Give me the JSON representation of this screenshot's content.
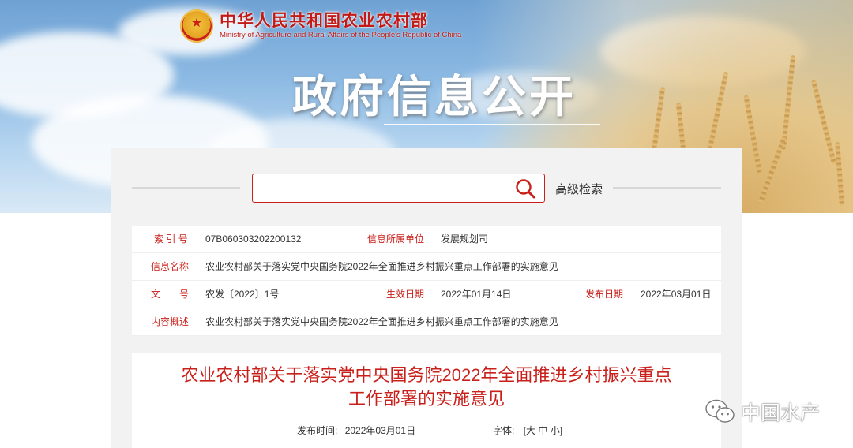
{
  "header": {
    "ministry_name_cn": "中华人民共和国农业农村部",
    "ministry_name_en": "Ministry of Agriculture and Rural Affairs of the People's Republic of China",
    "page_heading": "政府信息公开"
  },
  "search": {
    "placeholder": "",
    "value": "",
    "advanced_label": "高级检索"
  },
  "info": {
    "index_label": "索 引 号",
    "index_value": "07B060303202200132",
    "unit_label": "信息所属单位",
    "unit_value": "发展规划司",
    "name_label": "信息名称",
    "name_value": "农业农村部关于落实党中央国务院2022年全面推进乡村振兴重点工作部署的实施意见",
    "doc_label": "文　　号",
    "doc_value": "农发〔2022〕1号",
    "effective_label": "生效日期",
    "effective_value": "2022年01月14日",
    "publish_label": "发布日期",
    "publish_value": "2022年03月01日",
    "summary_label": "内容概述",
    "summary_value": "农业农村部关于落实党中央国务院2022年全面推进乡村振兴重点工作部署的实施意见"
  },
  "article": {
    "title_line1": "农业农村部关于落实党中央国务院2022年全面推进乡村振兴重点",
    "title_line2": "工作部署的实施意见",
    "publish_time_label": "发布时间:",
    "publish_time_value": "2022年03月01日",
    "font_label": "字体:",
    "font_open": "[",
    "font_large": "大",
    "font_medium": "中",
    "font_small": "小",
    "font_close": "]"
  },
  "watermark": {
    "text": "中国水产"
  },
  "colors": {
    "accent_red": "#c9201b",
    "panel_gray": "#f2f2f2"
  }
}
